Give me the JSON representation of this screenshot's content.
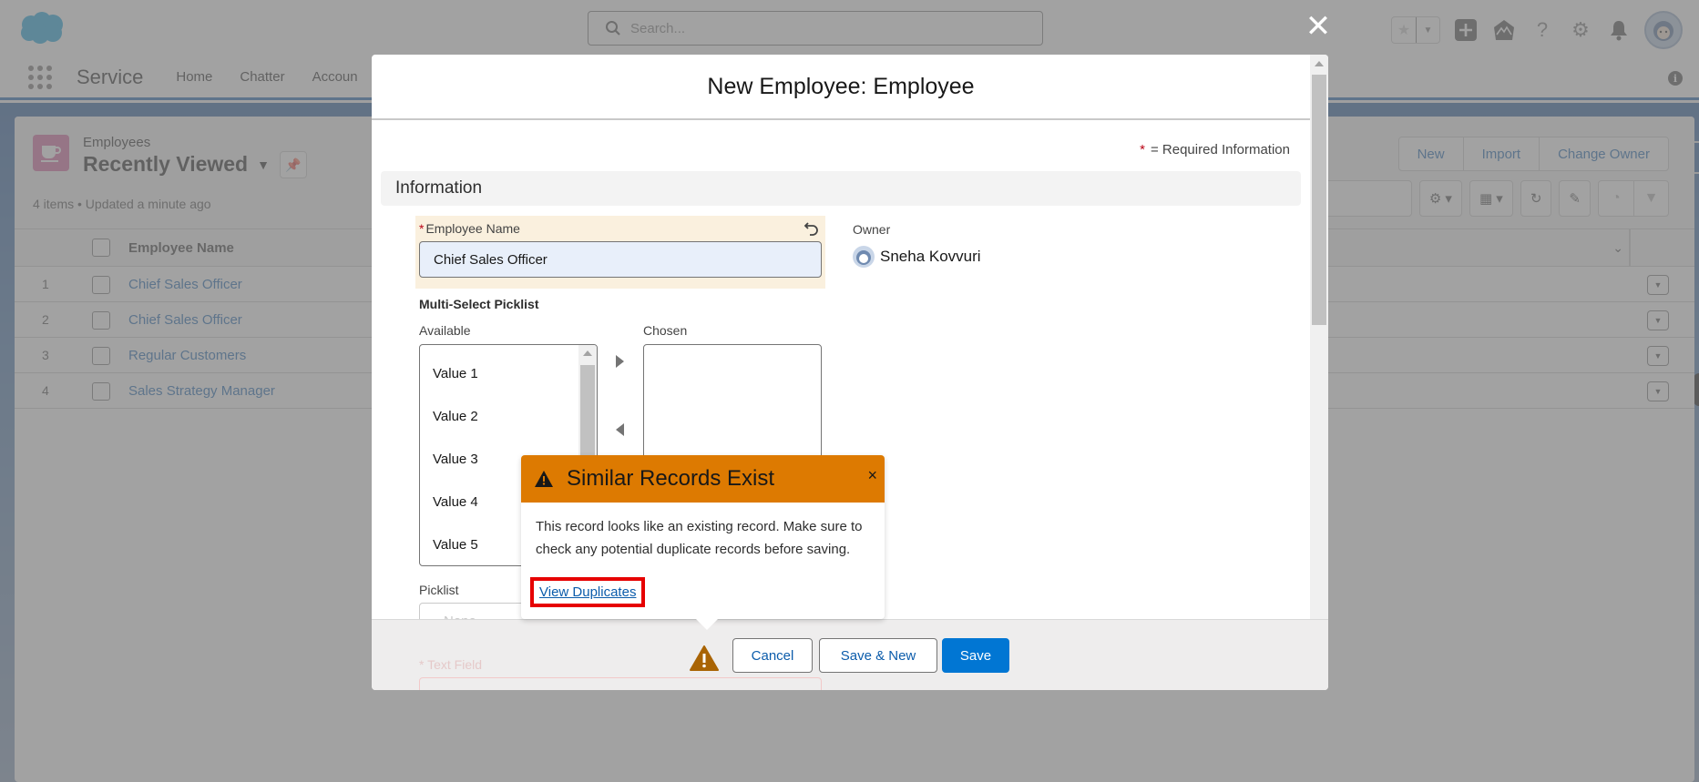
{
  "global_header": {
    "search_placeholder": "Search...",
    "icons": [
      "favorites-star-icon",
      "favorites-dropdown-icon",
      "global-actions-plus-icon",
      "trailhead-icon",
      "help-icon",
      "setup-gear-icon",
      "notifications-bell-icon",
      "user-avatar"
    ]
  },
  "nav": {
    "app_name": "Service",
    "items": [
      "Home",
      "Chatter",
      "Accoun"
    ]
  },
  "list_view": {
    "object_label": "Employees",
    "view_name": "Recently Viewed",
    "meta": "4 items • Updated a minute ago",
    "actions": [
      "New",
      "Import",
      "Change Owner"
    ],
    "column_header": "Employee Name",
    "rows": [
      {
        "num": "1",
        "name": "Chief Sales Officer"
      },
      {
        "num": "2",
        "name": "Chief Sales Officer"
      },
      {
        "num": "3",
        "name": "Regular Customers"
      },
      {
        "num": "4",
        "name": "Sales Strategy Manager"
      }
    ]
  },
  "modal": {
    "title": "New Employee: Employee",
    "required_star": "*",
    "required_info": "= Required Information",
    "section": "Information",
    "employee_name": {
      "label": "Employee Name",
      "required": "*",
      "value": "Chief Sales Officer"
    },
    "owner": {
      "label": "Owner",
      "value": "Sneha Kovvuri"
    },
    "multi_select": {
      "title": "Multi-Select Picklist",
      "available_label": "Available",
      "chosen_label": "Chosen",
      "available": [
        "Value 1",
        "Value 2",
        "Value 3",
        "Value 4",
        "Value 5"
      ],
      "chosen": []
    },
    "picklist": {
      "label": "Picklist",
      "value": "--None--"
    },
    "text_field": {
      "label": "Text Field",
      "required": "*"
    },
    "footer": {
      "cancel": "Cancel",
      "save_new": "Save & New",
      "save": "Save"
    }
  },
  "duplicate_popover": {
    "title": "Similar Records Exist",
    "body": "This record looks like an existing record. Make sure to check any potential duplicate records before saving.",
    "link": "View Duplicates",
    "close": "×",
    "header_color": "#dd7a01",
    "highlight_color": "#e60000"
  },
  "colors": {
    "brand_blue": "#0176d3",
    "link_blue": "#0b5cab",
    "required_red": "#ba0517"
  }
}
